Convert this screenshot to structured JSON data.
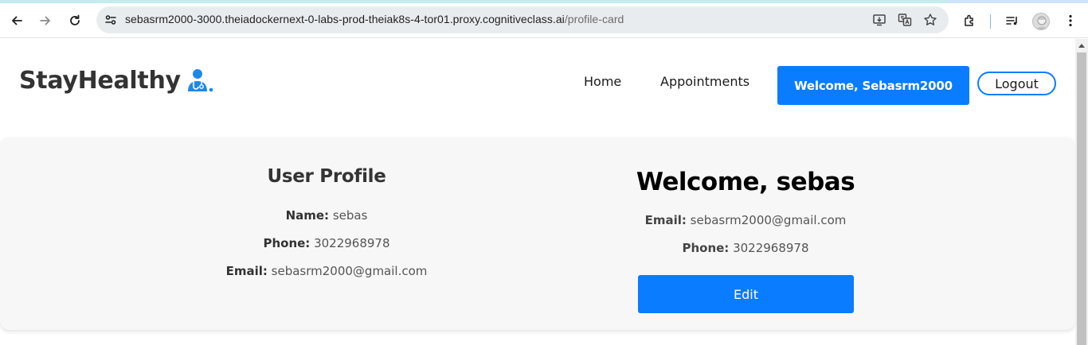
{
  "browser": {
    "url_host": "sebasrm2000-3000.theiadockernext-0-labs-prod-theiak8s-4-tor01.proxy.cognitiveclass.ai",
    "url_path": "/profile-card"
  },
  "navbar": {
    "brand": "StayHealthy",
    "links": {
      "home": "Home",
      "appointments": "Appointments"
    },
    "welcome_button": "Welcome, Sebasrm2000",
    "logout_button": "Logout"
  },
  "profile": {
    "title": "User Profile",
    "name_label": "Name:",
    "name_value": "sebas",
    "phone_label": "Phone:",
    "phone_value": "3022968978",
    "email_label": "Email:",
    "email_value": "sebasrm2000@gmail.com"
  },
  "welcome_card": {
    "title": "Welcome, sebas",
    "email_label": "Email:",
    "email_value": "sebasrm2000@gmail.com",
    "phone_label": "Phone:",
    "phone_value": "3022968978",
    "edit_button": "Edit"
  },
  "colors": {
    "accent": "#0a7cff",
    "brand_text": "#333333",
    "section_bg": "#f7f7f7"
  },
  "icons": {
    "toolbar": [
      "back-icon",
      "forward-icon",
      "reload-icon",
      "site-info-icon",
      "install-app-icon",
      "translate-icon",
      "bookmark-star-icon",
      "extensions-icon",
      "reading-list-icon",
      "profile-avatar-icon",
      "more-menu-icon"
    ],
    "brand_logo": "doctor-icon"
  }
}
